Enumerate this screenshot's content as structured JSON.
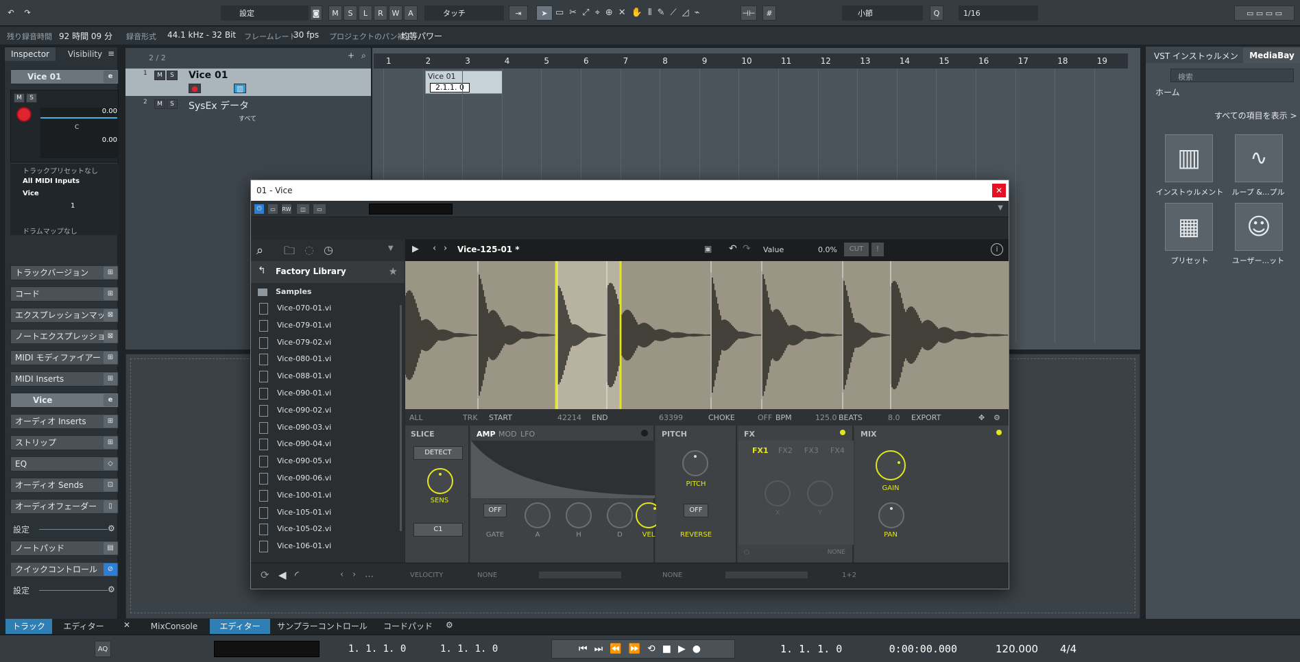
{
  "toolbar": {
    "undo": "↶",
    "redo": "↷",
    "config_preset": "設定",
    "modes": [
      "M",
      "S",
      "L",
      "R",
      "W",
      "A"
    ],
    "automation_mode": "タッチ",
    "grid_type": "小節",
    "quantize": "1/16"
  },
  "status": {
    "rec_time_label": "残り録音時間",
    "rec_time": "92 時間 09 分",
    "format_label": "録音形式",
    "format": "44.1 kHz - 32 Bit",
    "framerate_label": "フレームレート",
    "framerate": "30 fps",
    "pan_label": "プロジェクトのパン補正",
    "pan": "均等パワー"
  },
  "inspector": {
    "tabs": [
      "Inspector",
      "Visibility"
    ],
    "track_name": "Vice 01",
    "volume": "0.00",
    "pan_letter": "C",
    "delay": "0.00",
    "preset": "トラックプリセットなし",
    "midi_input": "All MIDI Inputs",
    "midi_output": "Vice",
    "channel": "1",
    "drum_map": "ドラムマップなし",
    "sections": [
      "トラックバージョン",
      "コード",
      "エクスプレッションマップ",
      "ノートエクスプレッション",
      "MIDI モディファイアー",
      "MIDI Inserts"
    ],
    "instrument": "Vice",
    "sections2": [
      "オーディオ Inserts",
      "ストリップ",
      "EQ",
      "オーディオ Sends",
      "オーディオフェーダー"
    ],
    "settings": "設定",
    "notepad": "ノートパッド",
    "quick_controls": "クイックコントロール",
    "settings2": "設定"
  },
  "project": {
    "track_count": "2 / 2",
    "tracks": [
      {
        "num": "1",
        "name": "Vice 01"
      },
      {
        "num": "2",
        "name": "SysEx データ"
      }
    ],
    "sysex_label": "すべて",
    "ruler": [
      "1",
      "2",
      "3",
      "4",
      "5",
      "6",
      "7",
      "8",
      "9",
      "10",
      "11",
      "12",
      "13",
      "14",
      "15",
      "16",
      "17",
      "18",
      "19"
    ],
    "event_name": "Vice 01",
    "event_pos": "2.1.1. 0"
  },
  "right": {
    "tabs": [
      "VST インストゥルメント",
      "MediaBay"
    ],
    "search_placeholder": "検索",
    "home": "ホーム",
    "show_all": "すべての項目を表示 >",
    "tiles": [
      "インストゥルメント",
      "ループ &...プル",
      "プリセット",
      "ユーザー...ット"
    ]
  },
  "plugin": {
    "title": "01 - Vice",
    "browser_root": "Factory Library",
    "folder": "Samples",
    "files": [
      "Vice-070-01.vi",
      "Vice-079-01.vi",
      "Vice-079-02.vi",
      "Vice-080-01.vi",
      "Vice-088-01.vi",
      "Vice-090-01.vi",
      "Vice-090-02.vi",
      "Vice-090-03.vi",
      "Vice-090-04.vi",
      "Vice-090-05.vi",
      "Vice-090-06.vi",
      "Vice-100-01.vi",
      "Vice-105-01.vi",
      "Vice-105-02.vi",
      "Vice-106-01.vi"
    ],
    "patch_name": "Vice-125-01 *",
    "value_label": "Value",
    "value": "0.0%",
    "cut": "CUT",
    "params": {
      "all": "ALL",
      "trk": "TRK",
      "start_label": "START",
      "start": "42214",
      "end_label": "END",
      "end": "63399",
      "choke_label": "CHOKE",
      "choke": "OFF",
      "bpm_label": "BPM",
      "bpm": "125.0",
      "beats_label": "BEATS",
      "beats": "8.0",
      "export": "EXPORT"
    },
    "slice": {
      "title": "SLICE",
      "detect": "DETECT",
      "sens": "SENS",
      "note": "C1"
    },
    "amp": {
      "tabs": [
        "AMP",
        "MOD",
        "LFO"
      ],
      "off": "OFF",
      "knobs": [
        "GATE",
        "A",
        "H",
        "D",
        "VEL"
      ]
    },
    "pitch": {
      "title": "PITCH",
      "knob": "PITCH",
      "off": "OFF",
      "reverse": "REVERSE"
    },
    "fx": {
      "title": "FX",
      "tabs": [
        "FX1",
        "FX2",
        "FX3",
        "FX4"
      ],
      "x": "X",
      "y": "Y",
      "none": "NONE"
    },
    "mix": {
      "title": "MIX",
      "gain": "GAIN",
      "pan": "PAN"
    },
    "footer": {
      "velocity": "VELOCITY",
      "none1": "NONE",
      "none2": "NONE",
      "out": "1+2"
    }
  },
  "bottom_tabs": {
    "left": [
      "トラック",
      "エディター"
    ],
    "mid": [
      "MixConsole",
      "エディター",
      "サンプラーコントロール",
      "コードパッド"
    ]
  },
  "transport": {
    "aq": "AQ",
    "left_locator": "1. 1. 1.   0",
    "right_locator": "1. 1. 1.   0",
    "position": "1.  1.  1.    0",
    "time": "0:00:00.000",
    "tempo": "120.000",
    "signature": "4/4"
  },
  "colors": {
    "accent": "#e3e61e",
    "record": "#e0242f",
    "track_select": "#8ed8ff"
  }
}
